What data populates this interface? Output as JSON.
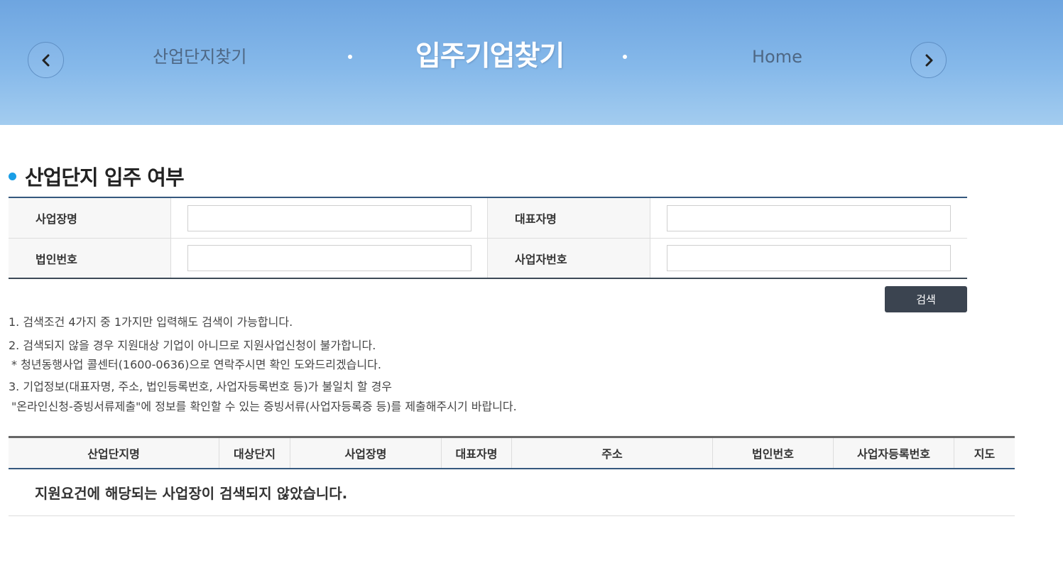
{
  "header": {
    "prev_label": "산업단지찾기",
    "current_label": "입주기업찾기",
    "next_label": "Home"
  },
  "section": {
    "title": "산업단지 입주 여부"
  },
  "form": {
    "business_name_label": "사업장명",
    "business_name_value": "",
    "representative_label": "대표자명",
    "representative_value": "",
    "corp_number_label": "법인번호",
    "corp_number_value": "",
    "biz_number_label": "사업자번호",
    "biz_number_value": "",
    "search_label": "검색"
  },
  "notes": [
    "1. 검색조건 4가지 중 1가지만 입력해도 검색이 가능합니다.",
    "2. 검색되지 않을 경우 지원대상 기업이 아니므로 지원사업신청이 불가합니다.",
    "  * 청년동행사업 콜센터(1600-0636)으로 연락주시면 확인 도와드리겠습니다.",
    "3. 기업정보(대표자명, 주소, 법인등록번호, 사업자등록번호 등)가 불일치 할 경우",
    "  \"온라인신청-증빙서류제출\"에 정보를 확인할 수 있는 증빙서류(사업자등록증 등)를 제출해주시기 바랍니다."
  ],
  "results": {
    "columns": [
      "산업단지명",
      "대상단지",
      "사업장명",
      "대표자명",
      "주소",
      "법인번호",
      "사업자등록번호",
      "지도"
    ],
    "empty_message": "지원요건에 해당되는 사업장이 검색되지 않았습니다."
  },
  "colors": {
    "header_gradient_top": "#6ea5e0",
    "header_gradient_bottom": "#a3ccef",
    "accent_bullet": "#1a9ee6",
    "search_button": "#3b4450",
    "table_border": "#35587e"
  }
}
